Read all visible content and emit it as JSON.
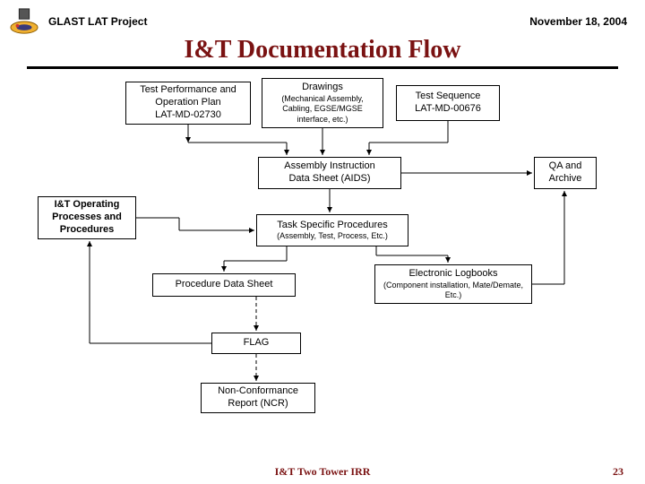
{
  "header": {
    "project": "GLAST LAT Project",
    "date": "November 18, 2004"
  },
  "title": "I&T Documentation Flow",
  "boxes": {
    "tpop": {
      "line1": "Test Performance and",
      "line2": "Operation Plan",
      "line3": "LAT-MD-02730"
    },
    "drawings": {
      "line1": "Drawings",
      "sub": "(Mechanical Assembly, Cabling, EGSE/MGSE interface, etc.)"
    },
    "testseq": {
      "line1": "Test Sequence",
      "line2": "LAT-MD-00676"
    },
    "aids": {
      "line1": "Assembly Instruction",
      "line2": "Data Sheet (AIDS)"
    },
    "qa": {
      "line1": "QA and",
      "line2": "Archive"
    },
    "opp": {
      "line1": "I&T Operating",
      "line2": "Processes and",
      "line3": "Procedures"
    },
    "tsp": {
      "line1": "Task Specific Procedures",
      "sub": "(Assembly, Test, Process, Etc.)"
    },
    "pds": {
      "line1": "Procedure Data Sheet"
    },
    "elog": {
      "line1": "Electronic Logbooks",
      "sub": "(Component installation, Mate/Demate, Etc.)"
    },
    "flag": {
      "line1": "FLAG"
    },
    "ncr": {
      "line1": "Non-Conformance",
      "line2": "Report (NCR)"
    }
  },
  "footer": {
    "label": "I&T Two Tower IRR",
    "page": "23"
  }
}
